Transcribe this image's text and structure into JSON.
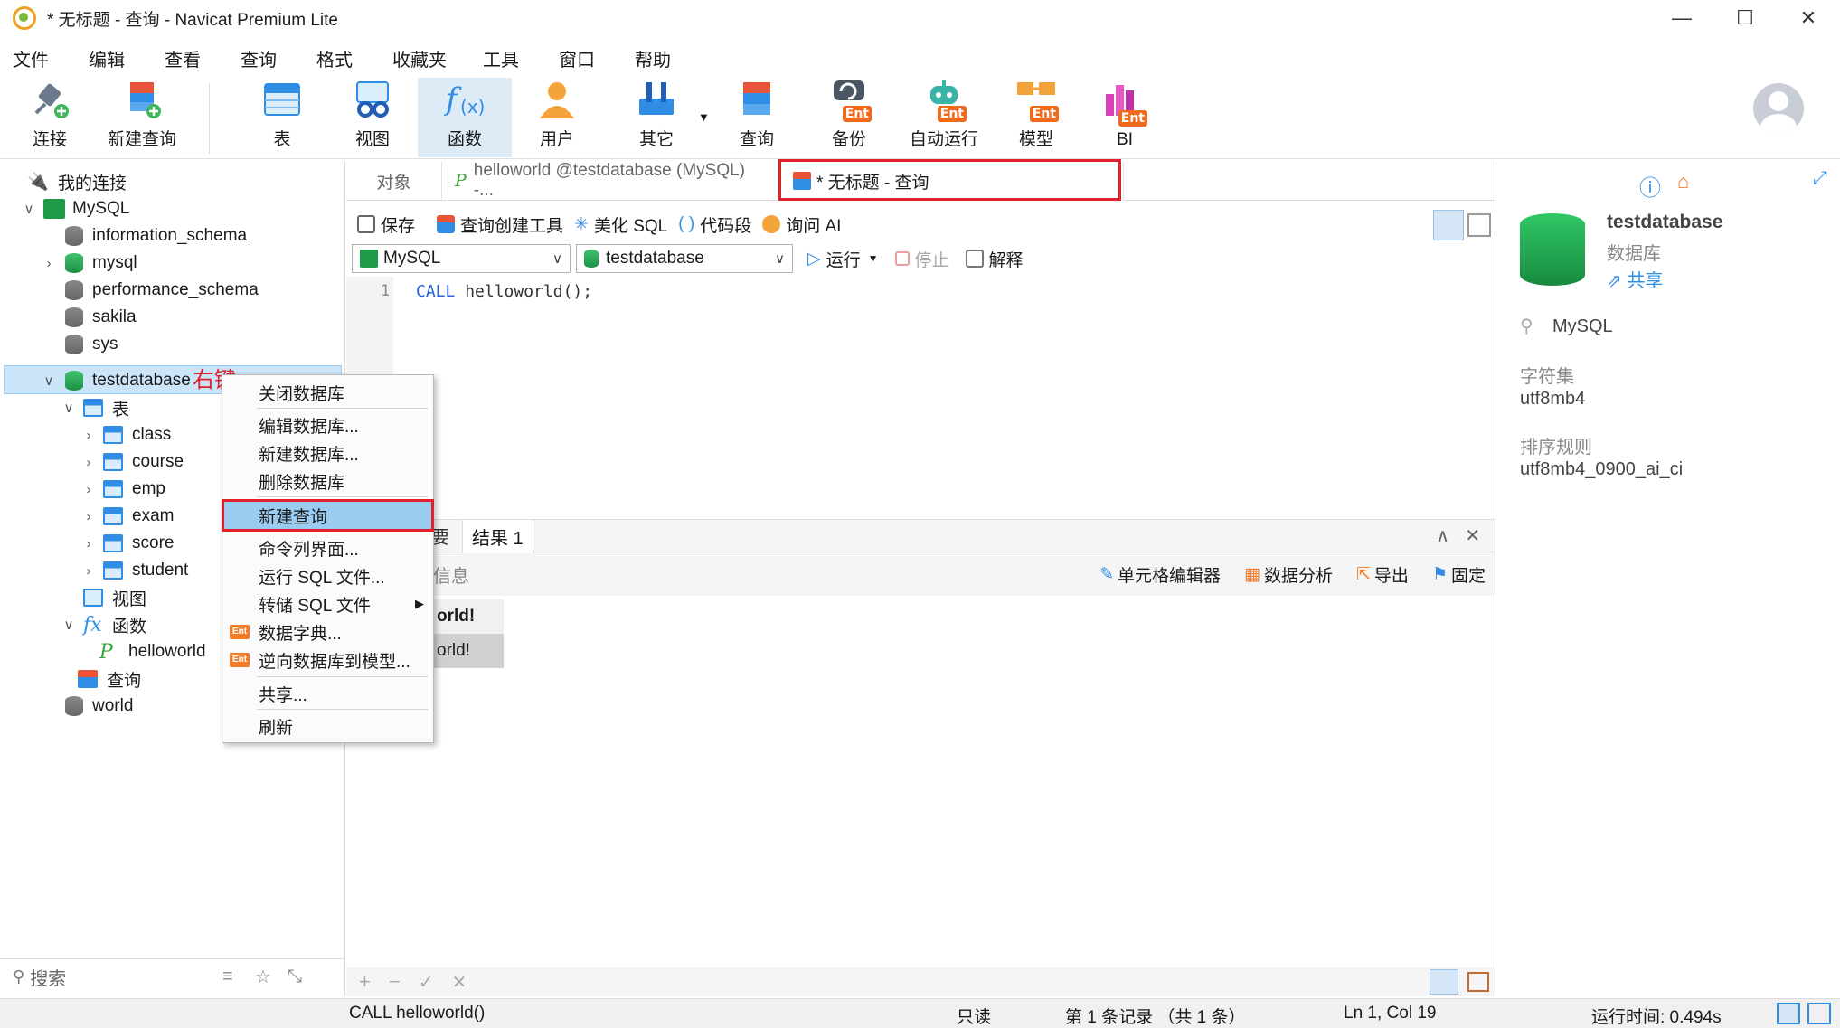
{
  "window": {
    "title": "* 无标题 - 查询 - Navicat Premium Lite",
    "min": "—",
    "max": "☐",
    "close": "✕"
  },
  "menu": [
    "文件",
    "编辑",
    "查看",
    "查询",
    "格式",
    "收藏夹",
    "工具",
    "窗口",
    "帮助"
  ],
  "toolbar": {
    "connect": "连接",
    "new_query": "新建查询",
    "table": "表",
    "view": "视图",
    "function": "函数",
    "user": "用户",
    "other": "其它",
    "query": "查询",
    "backup": "备份",
    "autorun": "自动运行",
    "model": "模型",
    "bi": "BI",
    "ent": "Ent"
  },
  "tree": {
    "root": "我的连接",
    "mysql": "MySQL",
    "dbs": [
      "information_schema",
      "mysql",
      "performance_schema",
      "sakila",
      "sys",
      "testdatabase"
    ],
    "tables_folder": "表",
    "tables": [
      "class",
      "course",
      "emp",
      "exam",
      "score",
      "student"
    ],
    "views": "视图",
    "functions": "函数",
    "function_item": "helloworld",
    "queries": "查询",
    "world": "world",
    "annotation": "右键"
  },
  "search": {
    "placeholder": "搜索"
  },
  "tabs": {
    "objects": "对象",
    "routine": "helloworld @testdatabase (MySQL) -...",
    "query": "* 无标题 - 查询"
  },
  "qtoolbar": {
    "save": "保存",
    "builder": "查询创建工具",
    "beautify": "美化 SQL",
    "snippet": "代码段",
    "ai": "询问 AI"
  },
  "selectors": {
    "connection": "MySQL",
    "database": "testdatabase",
    "run": "运行",
    "stop": "停止",
    "explain": "解释"
  },
  "editor": {
    "line": "1",
    "keyword": "CALL",
    "rest": " helloworld();"
  },
  "results": {
    "tab_summary": "要",
    "tab_result": "结果 1",
    "info": "信息",
    "cell_editor": "单元格编辑器",
    "analyze": "数据分析",
    "export": "导出",
    "pin": "固定",
    "cell_header": "orld!",
    "cell_value": "orld!"
  },
  "info_panel": {
    "name": "testdatabase",
    "type": "数据库",
    "share": "共享",
    "conn": "MySQL",
    "charset_label": "字符集",
    "charset": "utf8mb4",
    "collation_label": "排序规则",
    "collation": "utf8mb4_0900_ai_ci"
  },
  "context_menu": {
    "close_db": "关闭数据库",
    "edit_db": "编辑数据库...",
    "new_db": "新建数据库...",
    "delete_db": "删除数据库",
    "new_query": "新建查询",
    "cli": "命令列界面...",
    "run_sql": "运行 SQL 文件...",
    "dump_sql": "转储 SQL 文件",
    "dictionary": "数据字典...",
    "reverse": "逆向数据库到模型...",
    "share": "共享...",
    "refresh": "刷新"
  },
  "status": {
    "sql": "CALL helloworld()",
    "readonly": "只读",
    "record": "第 1 条记录 （共 1 条）",
    "position": "Ln 1, Col 19",
    "time": "运行时间: 0.494s"
  },
  "colors": {
    "accent": "#2f8de4",
    "highlight": "#99ccf0",
    "annotation_red": "#e0202a",
    "db_green": "#1e8f47"
  }
}
